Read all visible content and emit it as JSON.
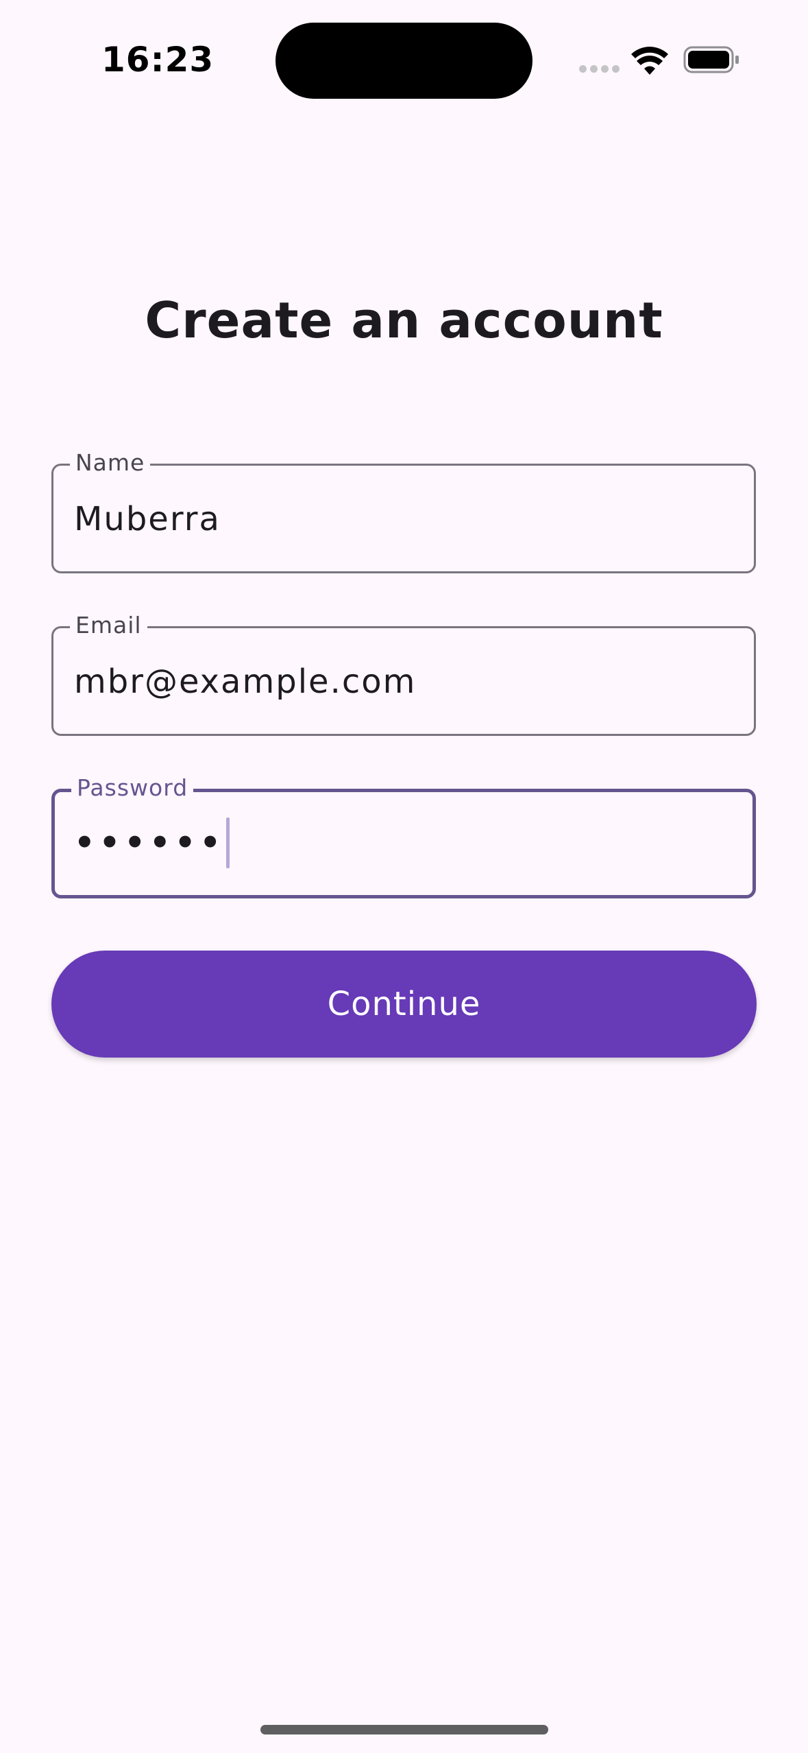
{
  "status_bar": {
    "time": "16:23",
    "icons": [
      "cellular-signal-icon",
      "wifi-icon",
      "battery-icon"
    ]
  },
  "page": {
    "title": "Create an account"
  },
  "form": {
    "name": {
      "label": "Name",
      "value": "Muberra"
    },
    "email": {
      "label": "Email",
      "value": "mbr@example.com"
    },
    "password": {
      "label": "Password",
      "value": "••••••",
      "focused": true
    }
  },
  "actions": {
    "continue_label": "Continue"
  },
  "colors": {
    "background": "#fef7fd",
    "primary": "#673ab7",
    "focus_outline": "#65558f",
    "outline": "#79747e",
    "text": "#1d1b20"
  }
}
